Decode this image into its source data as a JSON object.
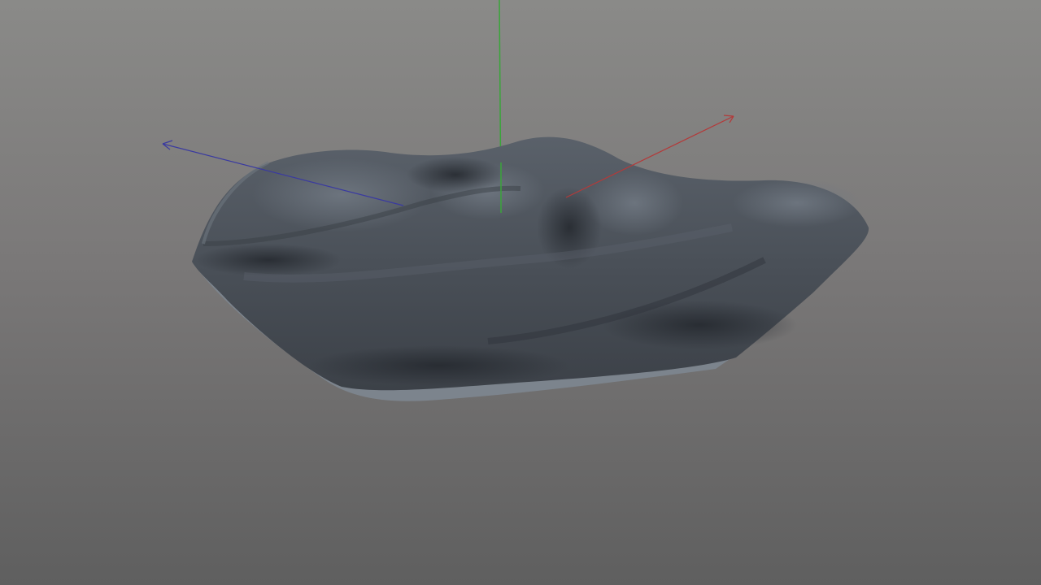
{
  "viewport": {
    "background_top": "#8a8a88",
    "background_bottom": "#5f5f5f",
    "mesh_color": "#4a5058",
    "mesh_highlight": "#6a727c",
    "mesh_shadow": "#2e333a",
    "mesh_rim": "#7c848d"
  },
  "gizmo": {
    "x_axis_color": "#b33a3a",
    "y_axis_color": "#3aa53a",
    "z_axis_color": "#3a3aa0"
  }
}
